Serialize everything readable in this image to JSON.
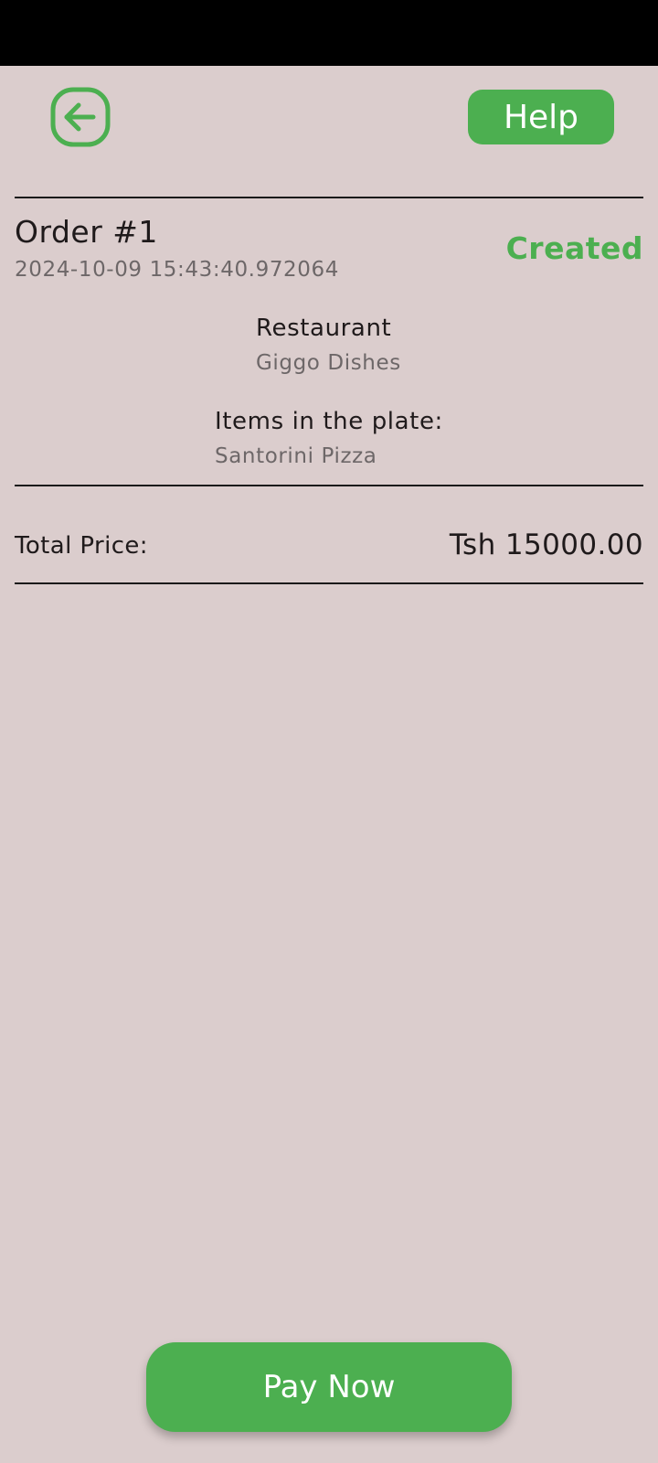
{
  "header": {
    "back_icon": "back-arrow-icon",
    "help_label": "Help"
  },
  "order": {
    "title": "Order #1",
    "timestamp": "2024-10-09 15:43:40.972064",
    "status": "Created",
    "restaurant_label": "Restaurant",
    "restaurant_name": "Giggo Dishes",
    "items_label": "Items in the plate:",
    "items": [
      "Santorini Pizza"
    ],
    "total_label": "Total Price:",
    "total_value": "Tsh 15000.00"
  },
  "footer": {
    "pay_label": "Pay Now"
  },
  "colors": {
    "accent": "#4caf50",
    "background": "#dbcdcd"
  }
}
